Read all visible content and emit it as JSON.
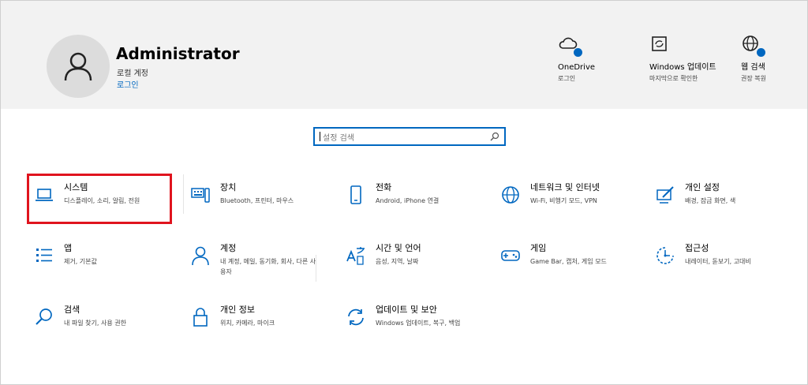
{
  "header": {
    "user_name": "Administrator",
    "account_type": "로컬 계정",
    "signin_link": "로그인",
    "quick_links": [
      {
        "title": "OneDrive",
        "sub": "로그인",
        "icon": "cloud-icon"
      },
      {
        "title": "Windows 업데이트",
        "sub": "마지막으로 확인한",
        "icon": "update-icon"
      },
      {
        "title": "웹 검색",
        "sub": "권장 복원",
        "icon": "globe-icon"
      }
    ]
  },
  "search": {
    "placeholder": "설정 검색"
  },
  "tiles": [
    {
      "name": "시스템",
      "desc": "디스플레이, 소리, 알림, 전원",
      "icon": "laptop-icon"
    },
    {
      "name": "장치",
      "desc": "Bluetooth, 프린터, 마우스",
      "icon": "keyboard-icon"
    },
    {
      "name": "전화",
      "desc": "Android, iPhone 연결",
      "icon": "phone-icon"
    },
    {
      "name": "네트워크 및 인터넷",
      "desc": "Wi-Fi, 비행기 모드, VPN",
      "icon": "globe-icon"
    },
    {
      "name": "개인 설정",
      "desc": "배경, 잠금 화면, 색",
      "icon": "paintbrush-icon"
    },
    {
      "name": "앱",
      "desc": "제거, 기본값",
      "icon": "apps-list-icon"
    },
    {
      "name": "계정",
      "desc": "내 계정, 메일, 동기화, 회사, 다른 사용자",
      "icon": "person-icon"
    },
    {
      "name": "시간 및 언어",
      "desc": "음성, 지역, 날짜",
      "icon": "time-language-icon"
    },
    {
      "name": "게임",
      "desc": "Game Bar, 캡처, 게임 모드",
      "icon": "gamepad-icon"
    },
    {
      "name": "접근성",
      "desc": "내레이터, 돋보기, 고대비",
      "icon": "accessibility-icon"
    },
    {
      "name": "검색",
      "desc": "내 파일 찾기, 사용 권한",
      "icon": "search-icon"
    },
    {
      "name": "개인 정보",
      "desc": "위치, 카메라, 마이크",
      "icon": "lock-icon"
    },
    {
      "name": "업데이트 및 보안",
      "desc": "Windows 업데이트, 복구, 백업",
      "icon": "sync-icon"
    }
  ],
  "colors": {
    "accent": "#0067c0",
    "highlight": "#e0141e",
    "header_bg": "#f2f2f2"
  }
}
